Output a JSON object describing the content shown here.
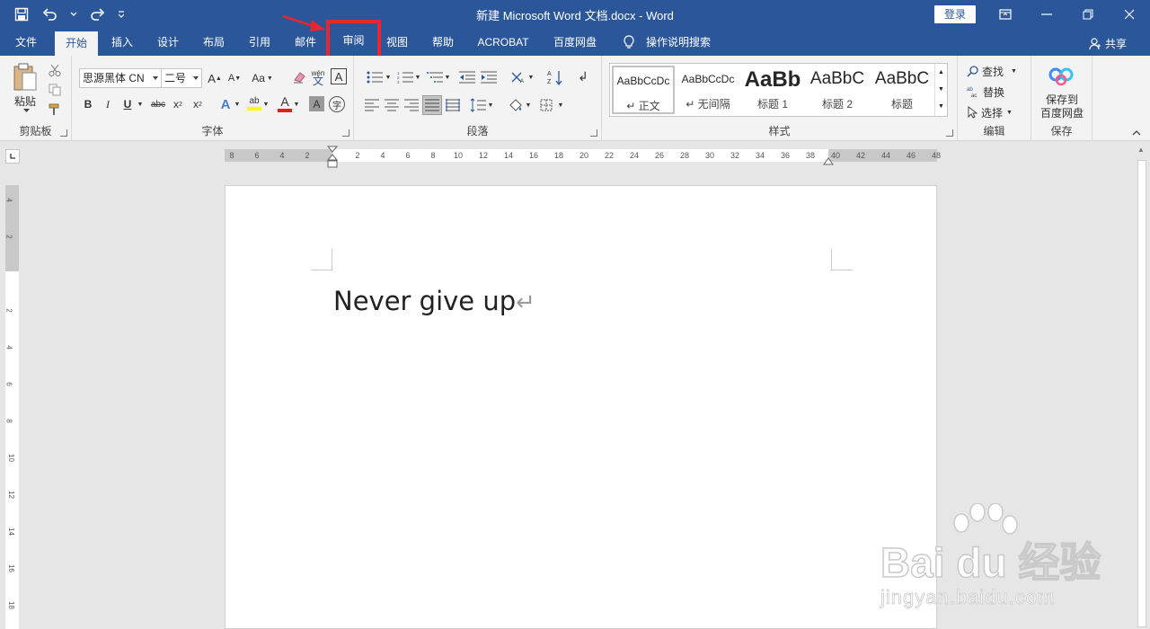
{
  "window": {
    "title": "新建 Microsoft Word 文档.docx  -  Word",
    "login_label": "登录"
  },
  "tabs": [
    {
      "label": "文件"
    },
    {
      "label": "开始"
    },
    {
      "label": "插入"
    },
    {
      "label": "设计"
    },
    {
      "label": "布局"
    },
    {
      "label": "引用"
    },
    {
      "label": "邮件"
    },
    {
      "label": "审阅"
    },
    {
      "label": "视图"
    },
    {
      "label": "帮助"
    },
    {
      "label": "ACROBAT"
    },
    {
      "label": "百度网盘"
    },
    {
      "label": "操作说明搜索"
    }
  ],
  "share_label": "共享",
  "ribbon": {
    "clipboard": {
      "paste_label": "粘贴",
      "group_label": "剪贴板"
    },
    "font": {
      "font_name": "思源黑体 CN",
      "font_size": "二号",
      "change_case": "Aa",
      "phonetic": "wén",
      "group_label": "字体"
    },
    "paragraph": {
      "group_label": "段落"
    },
    "styles": {
      "group_label": "样式",
      "items": [
        {
          "sample": "AaBbCcDc",
          "name": "↵ 正文"
        },
        {
          "sample": "AaBbCcDc",
          "name": "↵ 无间隔"
        },
        {
          "sample": "AaBb",
          "name": "标题 1"
        },
        {
          "sample": "AaBbC",
          "name": "标题 2"
        },
        {
          "sample": "AaBbC",
          "name": "标题"
        }
      ]
    },
    "editing": {
      "find": "查找",
      "replace": "替换",
      "select": "选择",
      "group_label": "编辑"
    },
    "save": {
      "label_line1": "保存到",
      "label_line2": "百度网盘",
      "group_label": "保存"
    }
  },
  "ruler": {
    "ticks": [
      "8",
      "6",
      "4",
      "2",
      "",
      "2",
      "4",
      "6",
      "8",
      "10",
      "12",
      "14",
      "16",
      "18",
      "20",
      "22",
      "24",
      "26",
      "28",
      "30",
      "32",
      "34",
      "36",
      "38",
      "40",
      "42",
      "44",
      "46",
      "48"
    ],
    "vticks": [
      "4",
      "2",
      "",
      "2",
      "4",
      "6",
      "8",
      "10",
      "12",
      "14",
      "16",
      "18"
    ]
  },
  "document": {
    "text": "Never give up",
    "paragraph_mark": "↵"
  },
  "watermark": {
    "brand": "Bai du 经验",
    "url": "jingyan.baidu.com"
  },
  "colors": {
    "title_bar": "#2b579a",
    "highlight_box": "#e8262f",
    "arrow": "#e8262f"
  }
}
